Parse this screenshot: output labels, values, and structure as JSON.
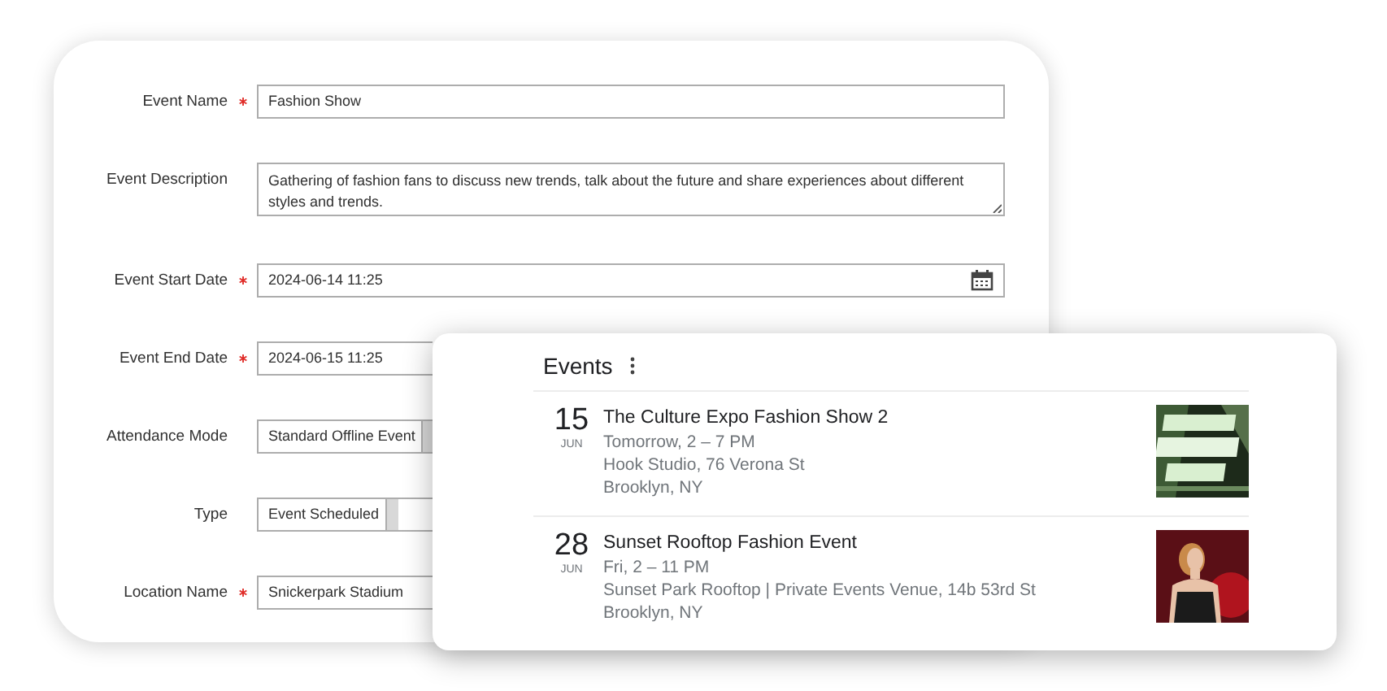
{
  "form": {
    "fields": [
      {
        "label": "Event Name",
        "required": true,
        "kind": "text",
        "value": "Fashion Show"
      },
      {
        "label": "Event Description",
        "required": false,
        "kind": "textarea",
        "value": "Gathering of fashion fans to discuss new trends, talk about the future and share experiences about different styles and trends."
      },
      {
        "label": "Event Start Date",
        "required": true,
        "kind": "date",
        "value": "2024-06-14 11:25"
      },
      {
        "label": "Event End Date",
        "required": true,
        "kind": "date",
        "value": "2024-06-15 11:25"
      },
      {
        "label": "Attendance Mode",
        "required": false,
        "kind": "select",
        "value": "Standard Offline Event"
      },
      {
        "label": "Type",
        "required": false,
        "kind": "select",
        "value": "Event Scheduled"
      },
      {
        "label": "Location Name",
        "required": true,
        "kind": "text",
        "value": "Snickerpark Stadium"
      }
    ]
  },
  "events": {
    "title": "Events",
    "items": [
      {
        "day": "15",
        "month": "JUN",
        "title": "The Culture Expo Fashion Show 2",
        "time": "Tomorrow, 2 – 7 PM",
        "venue": "Hook Studio, 76 Verona St",
        "city": "Brooklyn, NY"
      },
      {
        "day": "28",
        "month": "JUN",
        "title": "Sunset Rooftop Fashion Event",
        "time": "Fri, 2 – 11 PM",
        "venue": "Sunset Park Rooftop | Private Events Venue, 14b 53rd St",
        "city": "Brooklyn, NY"
      }
    ]
  }
}
